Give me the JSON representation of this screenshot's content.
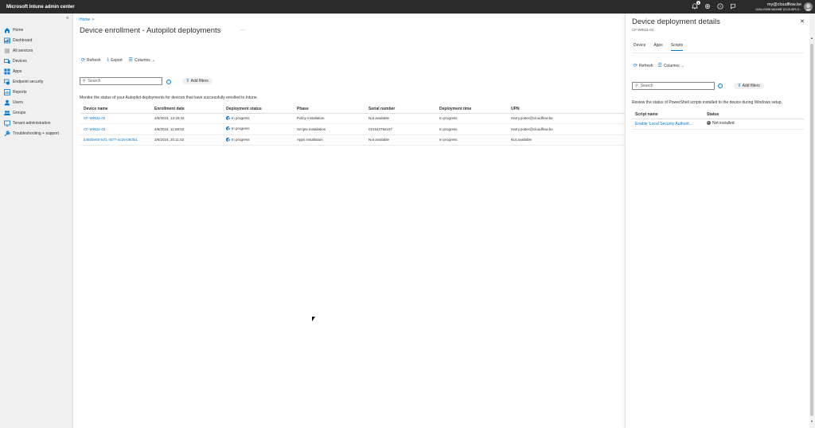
{
  "app": {
    "title": "Microsoft Intune admin center"
  },
  "topbar": {
    "notification_count": "1",
    "account_email": "my@cloudflow.be",
    "account_org": "GUILLEMIN MAXIME (CLOUDFLO..."
  },
  "sidebar": {
    "items": [
      {
        "label": "Home",
        "icon": "home-icon"
      },
      {
        "label": "Dashboard",
        "icon": "dashboard-icon"
      },
      {
        "label": "All services",
        "icon": "all-services-icon"
      },
      {
        "label": "Devices",
        "icon": "devices-icon"
      },
      {
        "label": "Apps",
        "icon": "apps-icon"
      },
      {
        "label": "Endpoint security",
        "icon": "endpoint-security-icon"
      },
      {
        "label": "Reports",
        "icon": "reports-icon"
      },
      {
        "label": "Users",
        "icon": "users-icon"
      },
      {
        "label": "Groups",
        "icon": "groups-icon"
      },
      {
        "label": "Tenant administration",
        "icon": "tenant-admin-icon"
      },
      {
        "label": "Troubleshooting + support",
        "icon": "troubleshooting-icon"
      }
    ]
  },
  "main": {
    "breadcrumb": "Home",
    "title": "Device enrollment - Autopilot deployments",
    "toolbar": {
      "refresh": "Refresh",
      "export": "Export",
      "columns": "Columns"
    },
    "search_placeholder": "Search",
    "add_filters": "Add filters",
    "description": "Monitor the status of your Autopilot deployments for devices that have successfully enrolled to Intune.",
    "columns": [
      "Device name",
      "Enrollment date",
      "Deployment status",
      "Phase",
      "Serial number",
      "Deployment time",
      "UPN"
    ],
    "rows": [
      [
        "CF-WIN11-02",
        "4/6/2024, 12:16:32",
        "In progress",
        "Policy installation",
        "Not available",
        "In progress",
        "Harry.potter@cloudflow.be"
      ],
      [
        "CF-WIN11-03",
        "4/6/2024, 11:58:52",
        "In progress",
        "Scripts installation",
        "021542794157",
        "In progress",
        "Harry.potter@cloudflow.be"
      ],
      [
        "b492be55-5cf1-4077-ac26-b60fa1",
        "3/6/2024, 20:11:52",
        "In progress",
        "Apps installation",
        "Not available",
        "In progress",
        "Not available"
      ]
    ]
  },
  "panel": {
    "title": "Device deployment details",
    "subtitle": "CF-WIN11-02",
    "tabs": [
      "Device",
      "Apps",
      "Scripts"
    ],
    "active_tab": "Scripts",
    "toolbar": {
      "refresh": "Refresh",
      "columns": "Columns"
    },
    "search_placeholder": "Search",
    "add_filters": "Add filters",
    "description": "Review the status of PowerShell scripts installed to the device during Windows setup.",
    "columns": [
      "Script name",
      "Status"
    ],
    "rows": [
      [
        "Enable 'Local Security Authorit...",
        "Not installed"
      ]
    ]
  },
  "colors": {
    "accent": "#0078d4",
    "topbar": "#2b2b2b",
    "sidebar": "#f0f0f0"
  }
}
